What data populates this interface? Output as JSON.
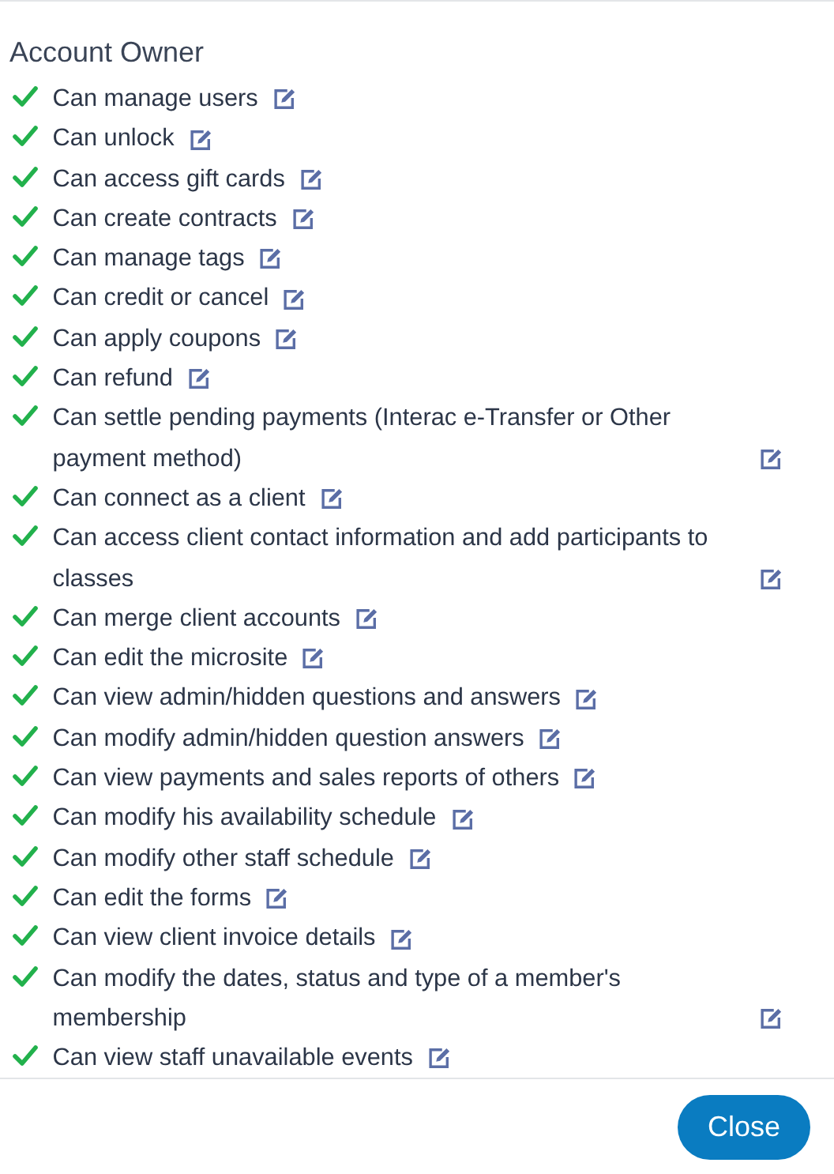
{
  "title": "Account Owner",
  "permissions": [
    {
      "label": "Can manage users",
      "granted": true
    },
    {
      "label": "Can unlock",
      "granted": true
    },
    {
      "label": "Can access gift cards",
      "granted": true
    },
    {
      "label": "Can create contracts",
      "granted": true
    },
    {
      "label": "Can manage tags",
      "granted": true
    },
    {
      "label": "Can credit or cancel",
      "granted": true
    },
    {
      "label": "Can apply coupons",
      "granted": true
    },
    {
      "label": "Can refund",
      "granted": true
    },
    {
      "label": "Can settle pending payments (Interac e-Transfer or Other payment method)",
      "granted": true
    },
    {
      "label": "Can connect as a client",
      "granted": true
    },
    {
      "label": "Can access client contact information and add participants to classes",
      "granted": true
    },
    {
      "label": "Can merge client accounts",
      "granted": true
    },
    {
      "label": "Can edit the microsite",
      "granted": true
    },
    {
      "label": "Can view admin/hidden questions and answers",
      "granted": true
    },
    {
      "label": "Can modify admin/hidden question answers",
      "granted": true
    },
    {
      "label": "Can view payments and sales reports of others",
      "granted": true
    },
    {
      "label": "Can modify his availability schedule",
      "granted": true
    },
    {
      "label": "Can modify other staff schedule",
      "granted": true
    },
    {
      "label": "Can edit the forms",
      "granted": true
    },
    {
      "label": "Can view client invoice details",
      "granted": true
    },
    {
      "label": "Can modify the dates, status and type of a member's membership",
      "granted": true
    },
    {
      "label": "Can view staff unavailable events",
      "granted": true
    }
  ],
  "buttons": [
    "Close"
  ]
}
